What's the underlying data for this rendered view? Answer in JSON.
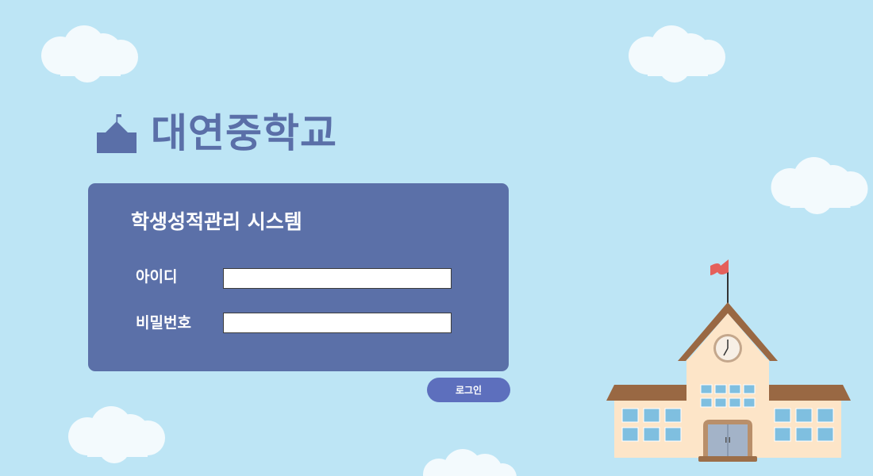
{
  "brand": {
    "school_name": "대연중학교"
  },
  "login": {
    "title": "학생성적관리 시스템",
    "id_label": "아이디",
    "id_value": "",
    "password_label": "비밀번호",
    "password_value": "",
    "submit_label": "로그인"
  },
  "icons": {
    "logo": "school-building-icon",
    "illustration": "school-building-illustration",
    "clouds": "cloud-icon"
  },
  "colors": {
    "background": "#bde5f5",
    "panel": "#5b70a8",
    "brand_text": "#5a6fa8",
    "button": "#5d6fbd"
  }
}
